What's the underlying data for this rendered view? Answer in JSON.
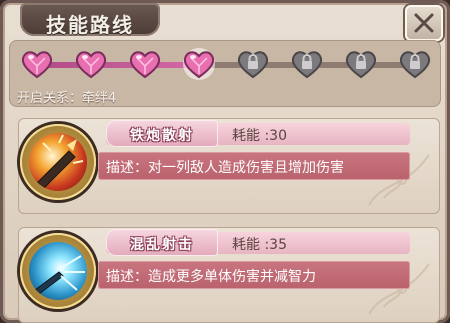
{
  "window": {
    "title": "技能路线",
    "close_icon": "close-x-icon"
  },
  "route": {
    "relation_label": "开启关系：牵绊4",
    "nodes": [
      {
        "state": "unlocked",
        "icon": "pink-heart-gem-icon"
      },
      {
        "state": "unlocked",
        "icon": "pink-heart-gem-icon"
      },
      {
        "state": "unlocked",
        "icon": "pink-heart-gem-icon"
      },
      {
        "state": "current",
        "icon": "pink-heart-gem-icon"
      },
      {
        "state": "locked",
        "icon": "locked-heart-icon"
      },
      {
        "state": "locked",
        "icon": "locked-heart-icon"
      },
      {
        "state": "locked",
        "icon": "locked-heart-icon"
      },
      {
        "state": "locked",
        "icon": "locked-heart-icon"
      }
    ],
    "progress_fraction": 0.43
  },
  "skills": [
    {
      "name": "铁炮散射",
      "cost": "耗能 :30",
      "description": "描述：对一列敌人造成伤害且增加伤害",
      "icon": "fire-blast-skill-icon"
    },
    {
      "name": "混乱射击",
      "cost": "耗能 :35",
      "description": "描述：造成更多单体伤害并减智力",
      "icon": "ice-shot-skill-icon"
    }
  ],
  "colors": {
    "accent_pink": "#d36aa7",
    "frame_brown": "#6e5a52",
    "desc_red": "#b9626d"
  }
}
